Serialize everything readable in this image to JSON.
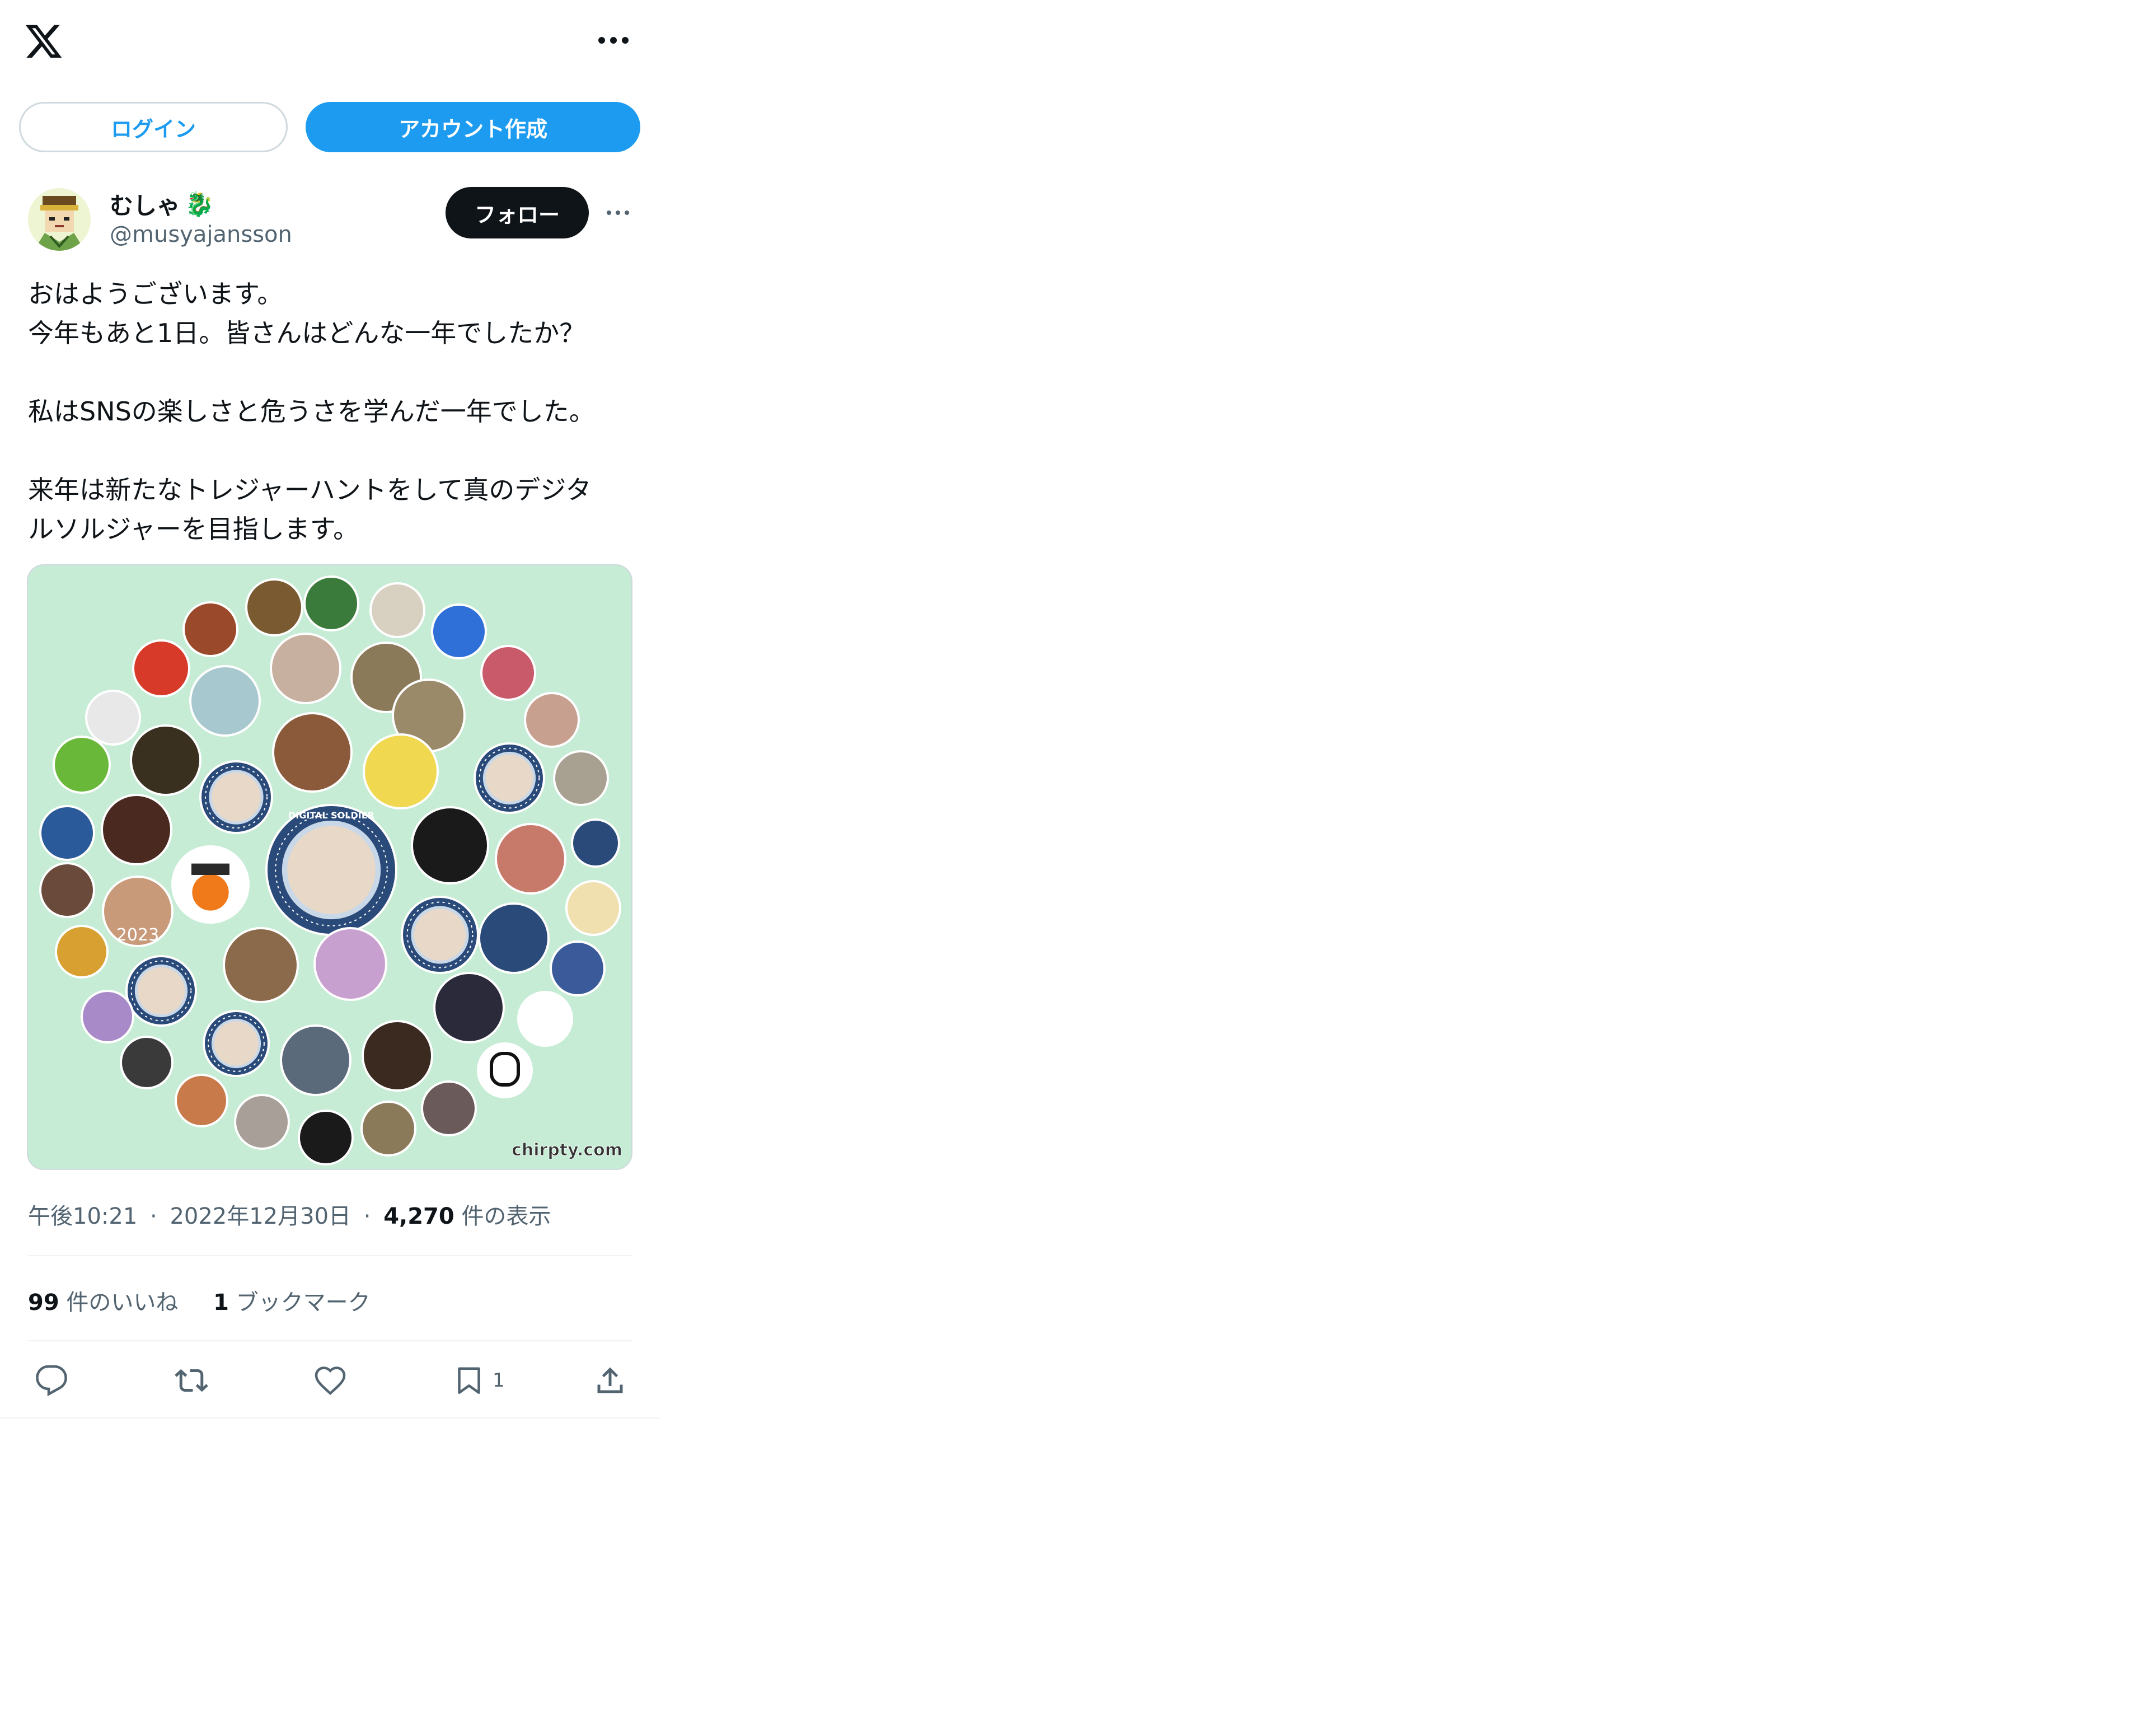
{
  "header": {
    "logo_icon": "x-logo-icon",
    "more_icon": "more-horizontal-icon"
  },
  "auth": {
    "login_label": "ログイン",
    "signup_label": "アカウント作成"
  },
  "tweet": {
    "author": {
      "display_name": "むしゃ",
      "name_emoji": "🐉",
      "username": "@musyajansson"
    },
    "follow_label": "フォロー",
    "text_lines": [
      "おはようございます。",
      "今年もあと1日。皆さんはどんな一年でしたか？",
      "",
      "私はSNSの楽しさと危うさを学んだ一年でした。",
      "",
      "来年は新たなトレジャーハントをして真のデジタ",
      "ルソルジャーを目指します。"
    ],
    "media": {
      "watermark": "chirpty.com",
      "overlay_text": "2023",
      "badge_text": "DIGITAL SOLDIER",
      "background": "#c6ecd5"
    },
    "meta": {
      "time": "午後10:21",
      "separator": "·",
      "date": "2022年12月30日",
      "views": "4,270",
      "views_label": "件の表示"
    },
    "stats": {
      "likes": "99",
      "likes_label": "件のいいね",
      "bookmarks": "1",
      "bookmarks_label": "ブックマーク"
    },
    "actions": {
      "reply_icon": "reply-icon",
      "retweet_icon": "retweet-icon",
      "like_icon": "heart-icon",
      "bookmark_icon": "bookmark-icon",
      "bookmark_count": "1",
      "share_icon": "share-icon"
    }
  },
  "colors": {
    "accent": "#1d9bf0",
    "text": "#0f1419",
    "secondary": "#536471",
    "divider": "#eff3f4"
  }
}
